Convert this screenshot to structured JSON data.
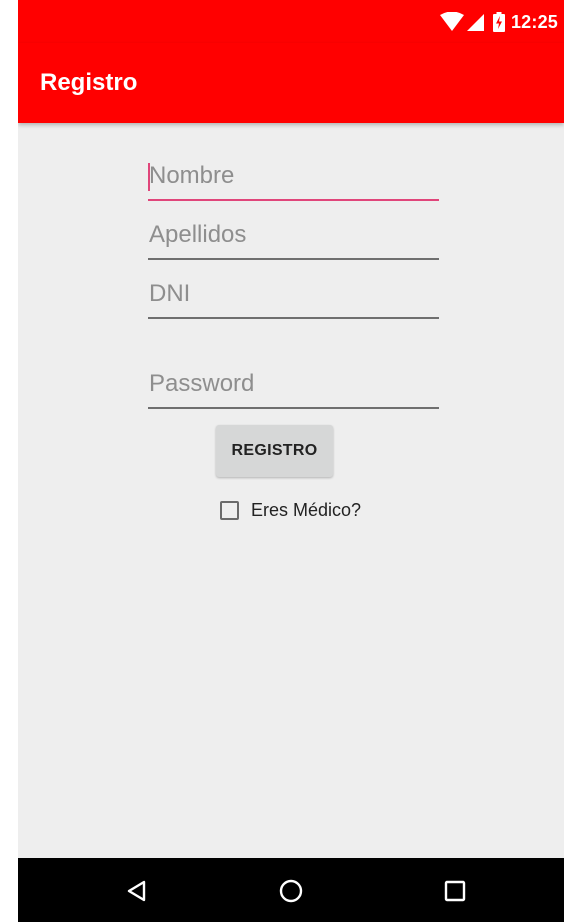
{
  "status_bar": {
    "time": "12:25",
    "icons": [
      "wifi-icon",
      "cell-signal-icon",
      "battery-charging-icon"
    ],
    "background": "#ff0000"
  },
  "app_bar": {
    "title": "Registro",
    "background": "#ff0000"
  },
  "form": {
    "nombre_placeholder": "Nombre",
    "apellidos_placeholder": "Apellidos",
    "dni_placeholder": "DNI",
    "password_placeholder": "Password",
    "submit_label": "REGISTRO",
    "medico_label": "Eres Médico?",
    "medico_checked": false,
    "focus_color": "#e0457a"
  },
  "nav_bar": {
    "buttons": [
      "back-icon",
      "home-icon",
      "recents-icon"
    ]
  }
}
